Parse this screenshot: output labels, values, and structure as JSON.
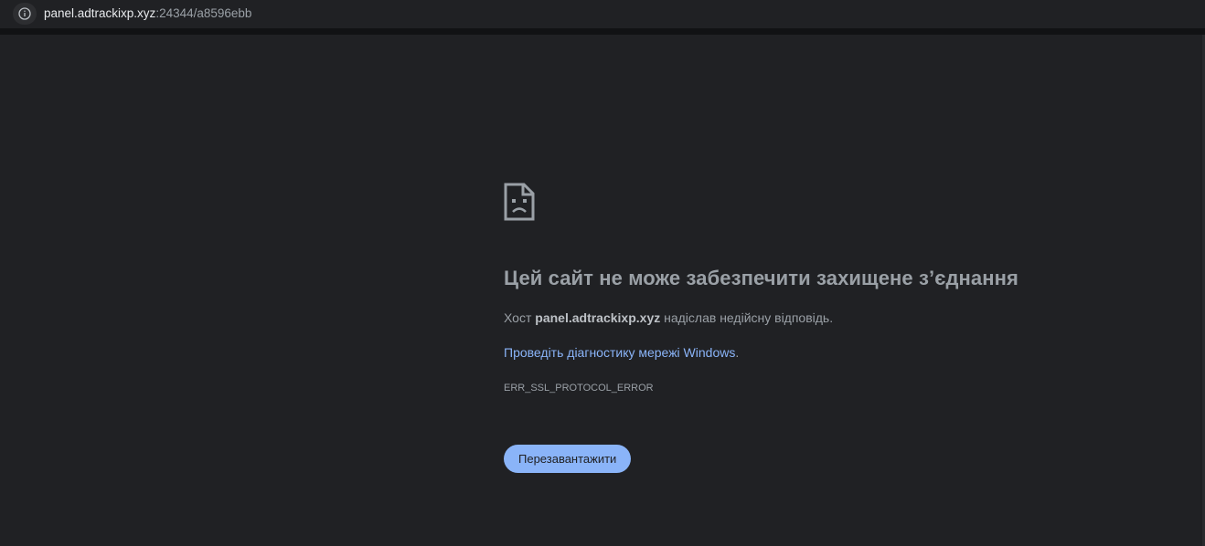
{
  "address_bar": {
    "host": "panel.adtrackixp.xyz",
    "rest": ":24344/a8596ebb",
    "info_icon": "info-icon"
  },
  "error_page": {
    "icon": "sad-page-icon",
    "title": "Цей сайт не може забезпечити захищене з’єднання",
    "desc_prefix": "Хост ",
    "desc_host": "panel.adtrackixp.xyz",
    "desc_suffix": " надіслав недійсну відповідь.",
    "diagnostics_link": "Проведіть діагностику мережі Windows",
    "diagnostics_suffix": ".",
    "error_code": "ERR_SSL_PROTOCOL_ERROR",
    "reload_label": "Перезавантажити"
  },
  "colors": {
    "background": "#202124",
    "title": "#9aa0a6",
    "link": "#8ab4f8",
    "button_bg": "#8ab4f8"
  }
}
